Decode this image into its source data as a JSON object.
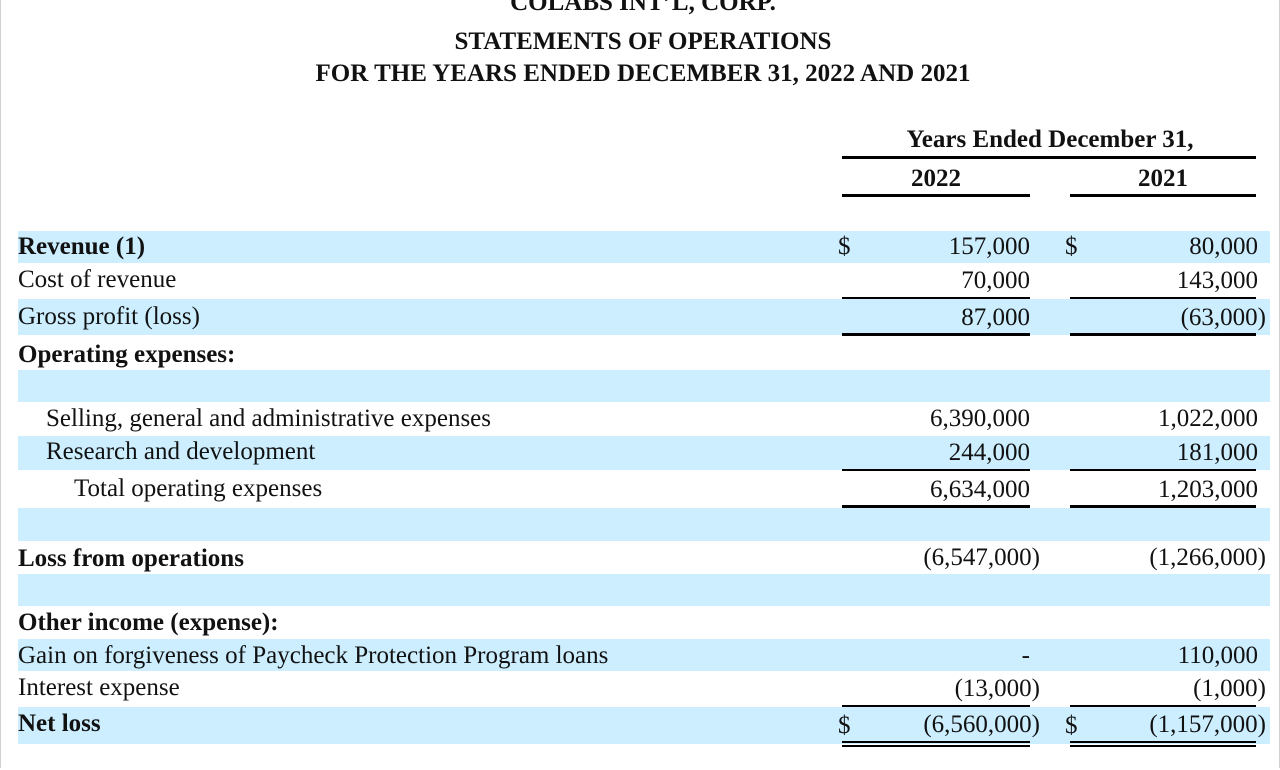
{
  "header": {
    "company": "COLABS INT’L, CORP.",
    "statement": "STATEMENTS OF OPERATIONS",
    "period": "FOR THE YEARS ENDED DECEMBER 31, 2022 AND 2021"
  },
  "columns": {
    "group_label": "Years Ended December 31,",
    "year1": "2022",
    "year2": "2021",
    "currency": "$"
  },
  "rows": {
    "revenue": {
      "label": "Revenue (1)",
      "v2022": "157,000",
      "v2021": "80,000"
    },
    "cost_of_revenue": {
      "label": "Cost of revenue",
      "v2022": "70,000",
      "v2021": "143,000"
    },
    "gross_profit": {
      "label": "Gross profit (loss)",
      "v2022": "87,000",
      "v2021": "(63,000)"
    },
    "operating_expenses": {
      "label": "Operating expenses:"
    },
    "sga": {
      "label": "Selling, general and administrative expenses",
      "v2022": "6,390,000",
      "v2021": "1,022,000"
    },
    "rnd": {
      "label": "Research and development",
      "v2022": "244,000",
      "v2021": "181,000"
    },
    "total_opex": {
      "label": "Total operating expenses",
      "v2022": "6,634,000",
      "v2021": "1,203,000"
    },
    "loss_from_ops": {
      "label": "Loss from operations",
      "v2022": "(6,547,000)",
      "v2021": "(1,266,000)"
    },
    "other_income": {
      "label": "Other income (expense):"
    },
    "ppp_gain": {
      "label": "Gain on forgiveness of Paycheck Protection Program loans",
      "v2022": "-",
      "v2021": "110,000"
    },
    "interest_expense": {
      "label": "Interest expense",
      "v2022": "(13,000)",
      "v2021": "(1,000)"
    },
    "net_loss": {
      "label": "Net loss",
      "v2022": "(6,560,000)",
      "v2021": "(1,157,000)"
    }
  }
}
